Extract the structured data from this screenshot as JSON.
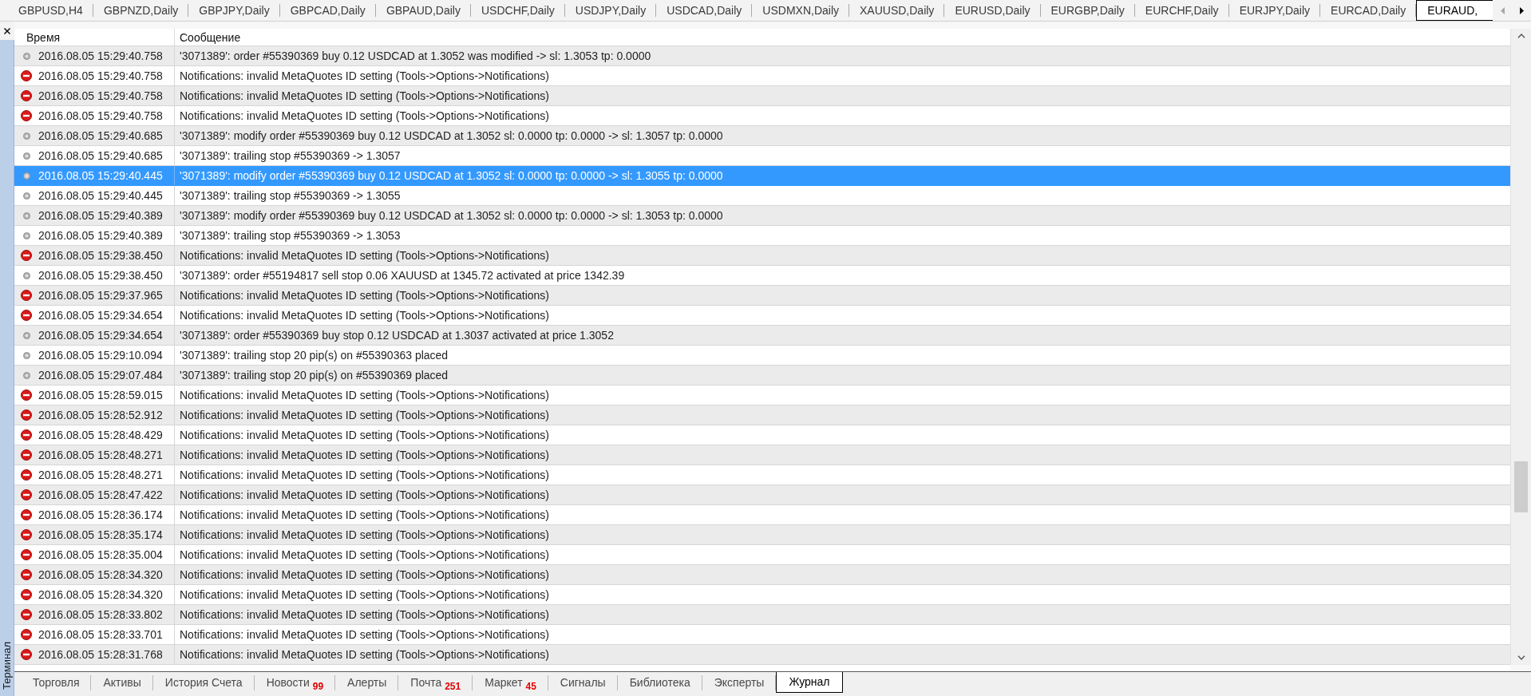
{
  "chart_tabs": [
    {
      "label": "GBPUSD,H4",
      "selected": false
    },
    {
      "label": "GBPNZD,Daily",
      "selected": false
    },
    {
      "label": "GBPJPY,Daily",
      "selected": false
    },
    {
      "label": "GBPCAD,Daily",
      "selected": false
    },
    {
      "label": "GBPAUD,Daily",
      "selected": false
    },
    {
      "label": "USDCHF,Daily",
      "selected": false
    },
    {
      "label": "USDJPY,Daily",
      "selected": false
    },
    {
      "label": "USDCAD,Daily",
      "selected": false
    },
    {
      "label": "USDMXN,Daily",
      "selected": false
    },
    {
      "label": "XAUUSD,Daily",
      "selected": false
    },
    {
      "label": "EURUSD,Daily",
      "selected": false
    },
    {
      "label": "EURGBP,Daily",
      "selected": false
    },
    {
      "label": "EURCHF,Daily",
      "selected": false
    },
    {
      "label": "EURJPY,Daily",
      "selected": false
    },
    {
      "label": "EURCAD,Daily",
      "selected": false
    },
    {
      "label": "EURAUD,",
      "selected": true
    }
  ],
  "chart_tab_scroller": {
    "back_enabled": false,
    "forward_enabled": true
  },
  "terminal_panel": {
    "title": "Терминал"
  },
  "journal": {
    "columns": [
      "Время",
      "Сообщение"
    ],
    "rows": [
      {
        "kind": "info",
        "time": "2016.08.05 15:29:40.758",
        "message": "'3071389': order #55390369 buy 0.12 USDCAD at 1.3052 was modified -> sl: 1.3053 tp: 0.0000",
        "selected": false
      },
      {
        "kind": "error",
        "time": "2016.08.05 15:29:40.758",
        "message": "Notifications: invalid MetaQuotes ID setting (Tools->Options->Notifications)",
        "selected": false
      },
      {
        "kind": "error",
        "time": "2016.08.05 15:29:40.758",
        "message": "Notifications: invalid MetaQuotes ID setting (Tools->Options->Notifications)",
        "selected": false
      },
      {
        "kind": "error",
        "time": "2016.08.05 15:29:40.758",
        "message": "Notifications: invalid MetaQuotes ID setting (Tools->Options->Notifications)",
        "selected": false
      },
      {
        "kind": "info",
        "time": "2016.08.05 15:29:40.685",
        "message": "'3071389': modify order #55390369 buy 0.12 USDCAD at 1.3052 sl: 0.0000 tp: 0.0000 -> sl: 1.3057 tp: 0.0000",
        "selected": false
      },
      {
        "kind": "info",
        "time": "2016.08.05 15:29:40.685",
        "message": "'3071389': trailing stop #55390369 -> 1.3057",
        "selected": false
      },
      {
        "kind": "info",
        "time": "2016.08.05 15:29:40.445",
        "message": "'3071389': modify order #55390369 buy 0.12 USDCAD at 1.3052 sl: 0.0000 tp: 0.0000 -> sl: 1.3055 tp: 0.0000",
        "selected": true
      },
      {
        "kind": "info",
        "time": "2016.08.05 15:29:40.445",
        "message": "'3071389': trailing stop #55390369 -> 1.3055",
        "selected": false
      },
      {
        "kind": "info",
        "time": "2016.08.05 15:29:40.389",
        "message": "'3071389': modify order #55390369 buy 0.12 USDCAD at 1.3052 sl: 0.0000 tp: 0.0000 -> sl: 1.3053 tp: 0.0000",
        "selected": false
      },
      {
        "kind": "info",
        "time": "2016.08.05 15:29:40.389",
        "message": "'3071389': trailing stop #55390369 -> 1.3053",
        "selected": false
      },
      {
        "kind": "error",
        "time": "2016.08.05 15:29:38.450",
        "message": "Notifications: invalid MetaQuotes ID setting (Tools->Options->Notifications)",
        "selected": false
      },
      {
        "kind": "info",
        "time": "2016.08.05 15:29:38.450",
        "message": "'3071389': order #55194817 sell stop 0.06 XAUUSD at 1345.72 activated at price 1342.39",
        "selected": false
      },
      {
        "kind": "error",
        "time": "2016.08.05 15:29:37.965",
        "message": "Notifications: invalid MetaQuotes ID setting (Tools->Options->Notifications)",
        "selected": false
      },
      {
        "kind": "error",
        "time": "2016.08.05 15:29:34.654",
        "message": "Notifications: invalid MetaQuotes ID setting (Tools->Options->Notifications)",
        "selected": false
      },
      {
        "kind": "info",
        "time": "2016.08.05 15:29:34.654",
        "message": "'3071389': order #55390369 buy stop 0.12 USDCAD at 1.3037 activated at price 1.3052",
        "selected": false
      },
      {
        "kind": "info",
        "time": "2016.08.05 15:29:10.094",
        "message": "'3071389': trailing stop 20 pip(s) on #55390363 placed",
        "selected": false
      },
      {
        "kind": "info",
        "time": "2016.08.05 15:29:07.484",
        "message": "'3071389': trailing stop 20 pip(s) on #55390369 placed",
        "selected": false
      },
      {
        "kind": "error",
        "time": "2016.08.05 15:28:59.015",
        "message": "Notifications: invalid MetaQuotes ID setting (Tools->Options->Notifications)",
        "selected": false
      },
      {
        "kind": "error",
        "time": "2016.08.05 15:28:52.912",
        "message": "Notifications: invalid MetaQuotes ID setting (Tools->Options->Notifications)",
        "selected": false
      },
      {
        "kind": "error",
        "time": "2016.08.05 15:28:48.429",
        "message": "Notifications: invalid MetaQuotes ID setting (Tools->Options->Notifications)",
        "selected": false
      },
      {
        "kind": "error",
        "time": "2016.08.05 15:28:48.271",
        "message": "Notifications: invalid MetaQuotes ID setting (Tools->Options->Notifications)",
        "selected": false
      },
      {
        "kind": "error",
        "time": "2016.08.05 15:28:48.271",
        "message": "Notifications: invalid MetaQuotes ID setting (Tools->Options->Notifications)",
        "selected": false
      },
      {
        "kind": "error",
        "time": "2016.08.05 15:28:47.422",
        "message": "Notifications: invalid MetaQuotes ID setting (Tools->Options->Notifications)",
        "selected": false
      },
      {
        "kind": "error",
        "time": "2016.08.05 15:28:36.174",
        "message": "Notifications: invalid MetaQuotes ID setting (Tools->Options->Notifications)",
        "selected": false
      },
      {
        "kind": "error",
        "time": "2016.08.05 15:28:35.174",
        "message": "Notifications: invalid MetaQuotes ID setting (Tools->Options->Notifications)",
        "selected": false
      },
      {
        "kind": "error",
        "time": "2016.08.05 15:28:35.004",
        "message": "Notifications: invalid MetaQuotes ID setting (Tools->Options->Notifications)",
        "selected": false
      },
      {
        "kind": "error",
        "time": "2016.08.05 15:28:34.320",
        "message": "Notifications: invalid MetaQuotes ID setting (Tools->Options->Notifications)",
        "selected": false
      },
      {
        "kind": "error",
        "time": "2016.08.05 15:28:34.320",
        "message": "Notifications: invalid MetaQuotes ID setting (Tools->Options->Notifications)",
        "selected": false
      },
      {
        "kind": "error",
        "time": "2016.08.05 15:28:33.802",
        "message": "Notifications: invalid MetaQuotes ID setting (Tools->Options->Notifications)",
        "selected": false
      },
      {
        "kind": "error",
        "time": "2016.08.05 15:28:33.701",
        "message": "Notifications: invalid MetaQuotes ID setting (Tools->Options->Notifications)",
        "selected": false
      },
      {
        "kind": "error",
        "time": "2016.08.05 15:28:31.768",
        "message": "Notifications: invalid MetaQuotes ID setting (Tools->Options->Notifications)",
        "selected": false
      }
    ]
  },
  "terminal_tabs": [
    {
      "label": "Торговля",
      "selected": false
    },
    {
      "label": "Активы",
      "selected": false
    },
    {
      "label": "История Счета",
      "selected": false
    },
    {
      "label": "Новости",
      "count": "99",
      "selected": false
    },
    {
      "label": "Алерты",
      "selected": false
    },
    {
      "label": "Почта",
      "count": "251",
      "selected": false
    },
    {
      "label": "Маркет",
      "count": "45",
      "selected": false
    },
    {
      "label": "Сигналы",
      "selected": false
    },
    {
      "label": "Библиотека",
      "selected": false
    },
    {
      "label": "Эксперты",
      "selected": false
    },
    {
      "label": "Журнал",
      "selected": true
    }
  ]
}
